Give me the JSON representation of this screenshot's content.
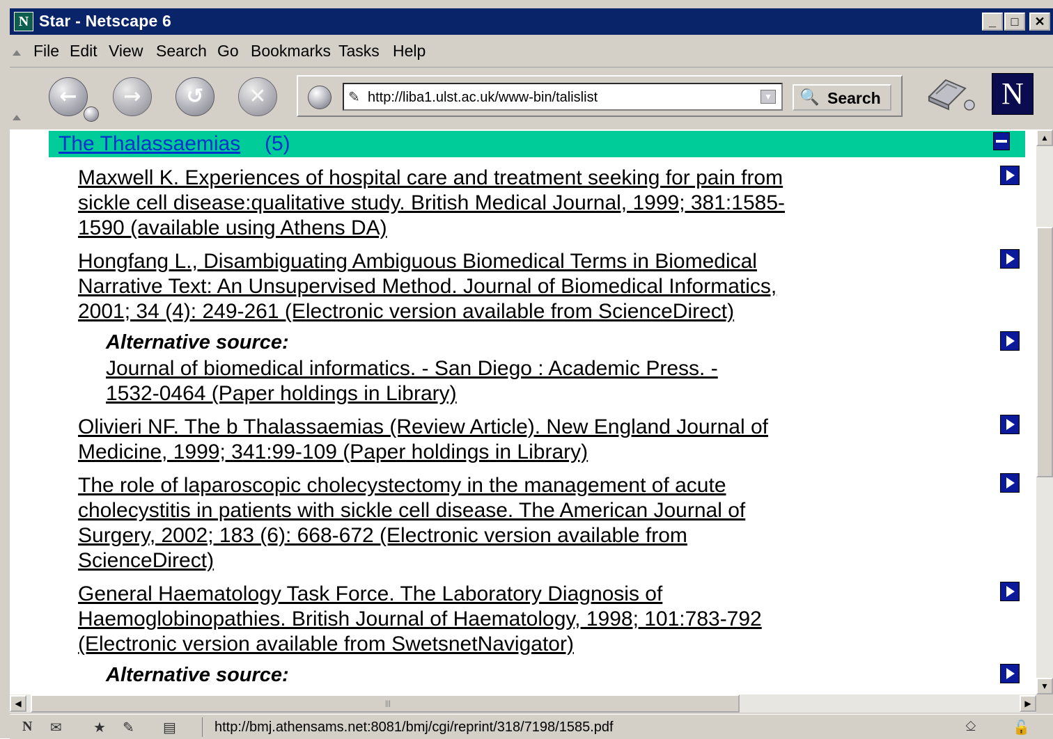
{
  "window": {
    "title": "Star - Netscape 6",
    "app_icon": "N",
    "controls": [
      "_",
      "□",
      "✕"
    ]
  },
  "menu": [
    "File",
    "Edit",
    "View",
    "Search",
    "Go",
    "Bookmarks",
    "Tasks",
    "Help"
  ],
  "toolbar": {
    "url": "http://liba1.ulst.ac.uk/www-bin/talislist",
    "search_label": "Search",
    "logo": "N"
  },
  "section": {
    "title": "The Thalassaemias",
    "count": "(5)"
  },
  "references": [
    {
      "text": "Maxwell K. Experiences of hospital care and treatment seeking for pain from sickle cell disease:qualitative study. British Medical Journal, 1999; 381:1585-1590 (available using Athens DA)"
    },
    {
      "text": "Hongfang L., Disambiguating Ambiguous Biomedical Terms in Biomedical Narrative Text: An Unsupervised Method. Journal of Biomedical Informatics, 2001; 34 (4): 249-261 (Electronic version available from ScienceDirect)",
      "alt_label": "Alternative source:",
      "alt_text": "Journal of biomedical informatics. - San Diego : Academic Press. - 1532-0464 (Paper holdings in Library)"
    },
    {
      "text": "Olivieri NF. The b Thalassaemias (Review Article). New England Journal of Medicine, 1999; 341:99-109 (Paper holdings in Library)"
    },
    {
      "text": "The role of laparoscopic cholecystectomy in the management of acute cholecystitis in patients with sickle cell disease. The American Journal of Surgery, 2002; 183 (6): 668-672 (Electronic version available from ScienceDirect)"
    },
    {
      "text": "General Haematology Task Force. The Laboratory Diagnosis of Haemoglobinopathies. British Journal of Haematology, 1998; 101:783-792 (Electronic version available from SwetsnetNavigator)",
      "alt_label": "Alternative source:"
    }
  ],
  "status": {
    "url": "http://bmj.athensams.net:8081/bmj/cgi/reprint/318/7198/1585.pdf"
  },
  "icons": [
    "back-icon",
    "forward-icon",
    "reload-icon",
    "stop-icon",
    "go-icon",
    "search-icon",
    "print-icon",
    "netscape-logo",
    "collapse-icon",
    "open-record-icon",
    "mail-icon",
    "instant-messenger-icon",
    "composer-icon",
    "address-book-icon",
    "connection-icon",
    "lock-icon"
  ]
}
